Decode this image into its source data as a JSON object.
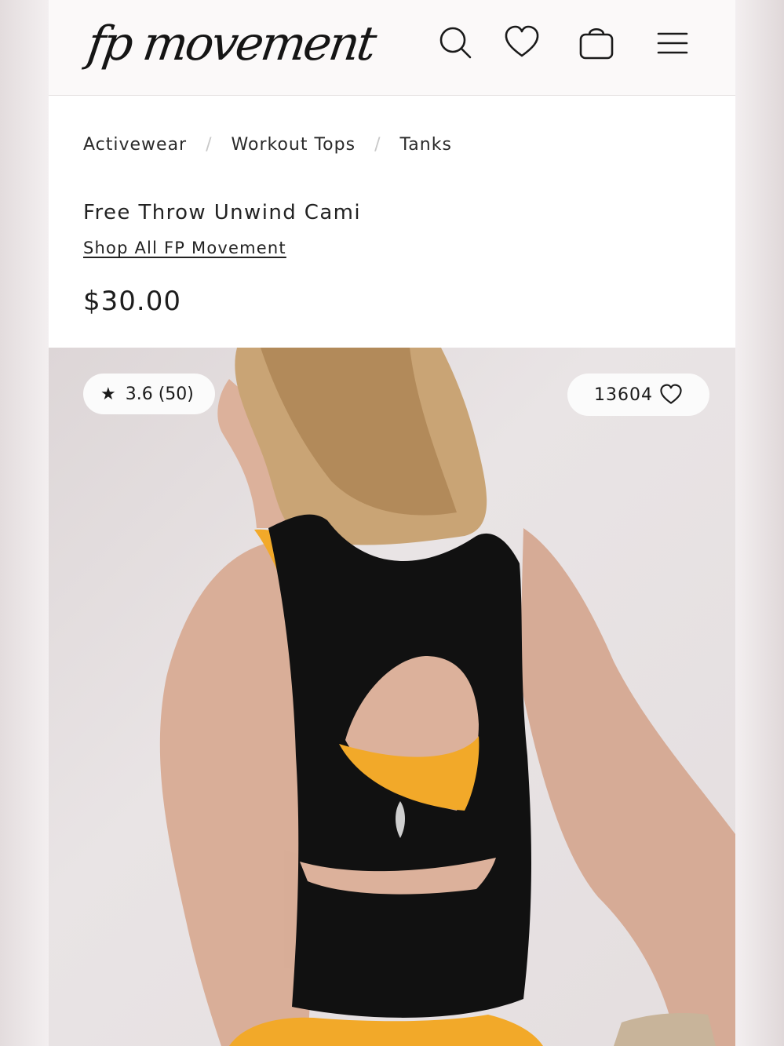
{
  "header": {
    "logo_text": "fp movement",
    "icons": [
      "search-icon",
      "heart-icon",
      "bag-icon",
      "menu-icon"
    ]
  },
  "breadcrumb": {
    "items": [
      "Activewear",
      "Workout Tops",
      "Tanks"
    ],
    "separator": "/"
  },
  "product": {
    "title": "Free Throw Unwind Cami",
    "shop_link": "Shop All FP Movement",
    "price": "$30.00"
  },
  "badges": {
    "rating": "3.6 (50)",
    "rating_icon": "star-icon",
    "favorites": "13604",
    "favorites_icon": "heart-outline-icon"
  },
  "colors": {
    "accent_yellow": "#f2a929",
    "tank_black": "#111111"
  }
}
